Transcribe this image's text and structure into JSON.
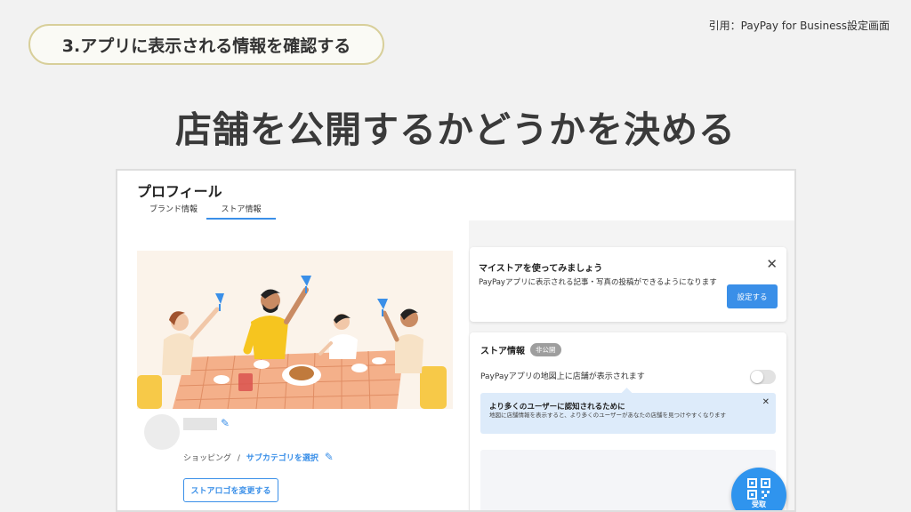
{
  "header": {
    "step_label": "3.アプリに表示される情報を確認する",
    "citation": "引用：PayPay for Business設定画面",
    "headline": "店舗を公開するかどうかを決める"
  },
  "profile": {
    "title": "プロフィール",
    "tabs": [
      {
        "label": "ブランド情報",
        "active": false
      },
      {
        "label": "ストア情報",
        "active": true
      }
    ],
    "category_label": "ショッピング",
    "category_separator": "/",
    "subcategory_link": "サブカテゴリを選択",
    "logo_button": "ストアロゴを変更する"
  },
  "mystore_card": {
    "title": "マイストアを使ってみましょう",
    "body": "PayPayアプリに表示される記事・写真の投稿ができるようになります",
    "button": "設定する"
  },
  "store_info": {
    "title": "ストア情報",
    "badge": "非公開",
    "map_label": "PayPayアプリの地図上に店舗が表示されます",
    "toggle_on": false,
    "notice": {
      "title": "より多くのユーザーに認知されるために",
      "body": "地図に店舗情報を表示すると、より多くのユーザーがあなたの店舗を見つけやすくなります"
    }
  },
  "fab": {
    "label": "受取",
    "icon": "qr-code-icon"
  },
  "colors": {
    "accent": "#3a8fe8",
    "background": "#f2f2f2",
    "pill_border": "#d8cf9a",
    "badge": "#9e9e9e",
    "notice_bg": "#ddebfa"
  }
}
